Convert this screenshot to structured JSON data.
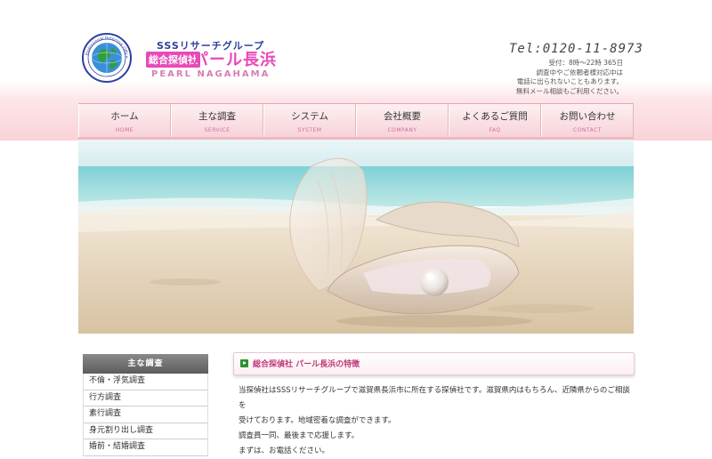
{
  "header": {
    "logo_group": "SSSリサーチグループ",
    "logo_box": "総合探偵社",
    "logo_name": "パール長浜",
    "logo_en": "PEARL NAGAHAMA",
    "emblem_text": "Professional Detective Office",
    "tel": "Tel:0120-11-8973",
    "contact_lines": [
      "受付：8時～22時 365日",
      "調査中やご依頼者様対応中は",
      "電話に出られないこともあります。",
      "無料メール相談もご利用ください。"
    ]
  },
  "nav": [
    {
      "jp": "ホーム",
      "en": "HOME"
    },
    {
      "jp": "主な調査",
      "en": "SERVICE"
    },
    {
      "jp": "システム",
      "en": "SYSTEM"
    },
    {
      "jp": "会社概要",
      "en": "COMPANY"
    },
    {
      "jp": "よくあるご質問",
      "en": "FAQ"
    },
    {
      "jp": "お問い合わせ",
      "en": "CONTACT"
    }
  ],
  "sidebar": {
    "title": "主な調査",
    "items": [
      "不倫・浮気調査",
      "行方調査",
      "素行調査",
      "身元割り出し調査",
      "婚前・結婚調査"
    ]
  },
  "content": {
    "heading": "総合探偵社 パール長浜の特徴",
    "lines": [
      "当探偵社はSSSリサーチグループで滋賀県長浜市に所在する探偵社です。滋賀県内はもちろん、近隣県からのご相談を",
      "受けております。地域密着な調査ができます。",
      "調査員一同、最後まで応援します。",
      "まずは、お電話ください。"
    ]
  },
  "colors": {
    "accent_pink": "#e84ab8",
    "logo_blue": "#2e3f9e",
    "nav_border": "#e7a4ad"
  }
}
